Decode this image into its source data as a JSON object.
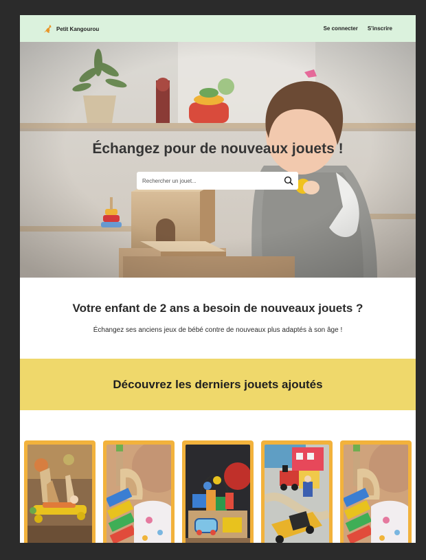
{
  "header": {
    "brand_name": "Petit Kangourou",
    "brand_icon": "kangaroo-icon",
    "login_label": "Se connecter",
    "signup_label": "S'inscrire",
    "background_color": "#dbf2dd"
  },
  "hero": {
    "title": "Échangez pour de nouveaux jouets !",
    "search": {
      "placeholder": "Rechercher un jouet...",
      "value": "",
      "icon": "search-icon"
    }
  },
  "intro": {
    "title": "Votre enfant de 2 ans a besoin de nouveaux jouets ?",
    "text": "Échangez ses anciens jeux de bébé contre de nouveaux plus adaptés à son âge !"
  },
  "latest": {
    "title": "Découvrez les derniers jouets ajoutés",
    "background_color": "#efd86b",
    "card_color": "#f2b23c",
    "cards": [
      {
        "image": "wooden-boat-toys"
      },
      {
        "image": "baby-with-xylophone"
      },
      {
        "image": "bead-maze-toy"
      },
      {
        "image": "wooden-train-set"
      },
      {
        "image": "baby-with-xylophone"
      }
    ]
  }
}
